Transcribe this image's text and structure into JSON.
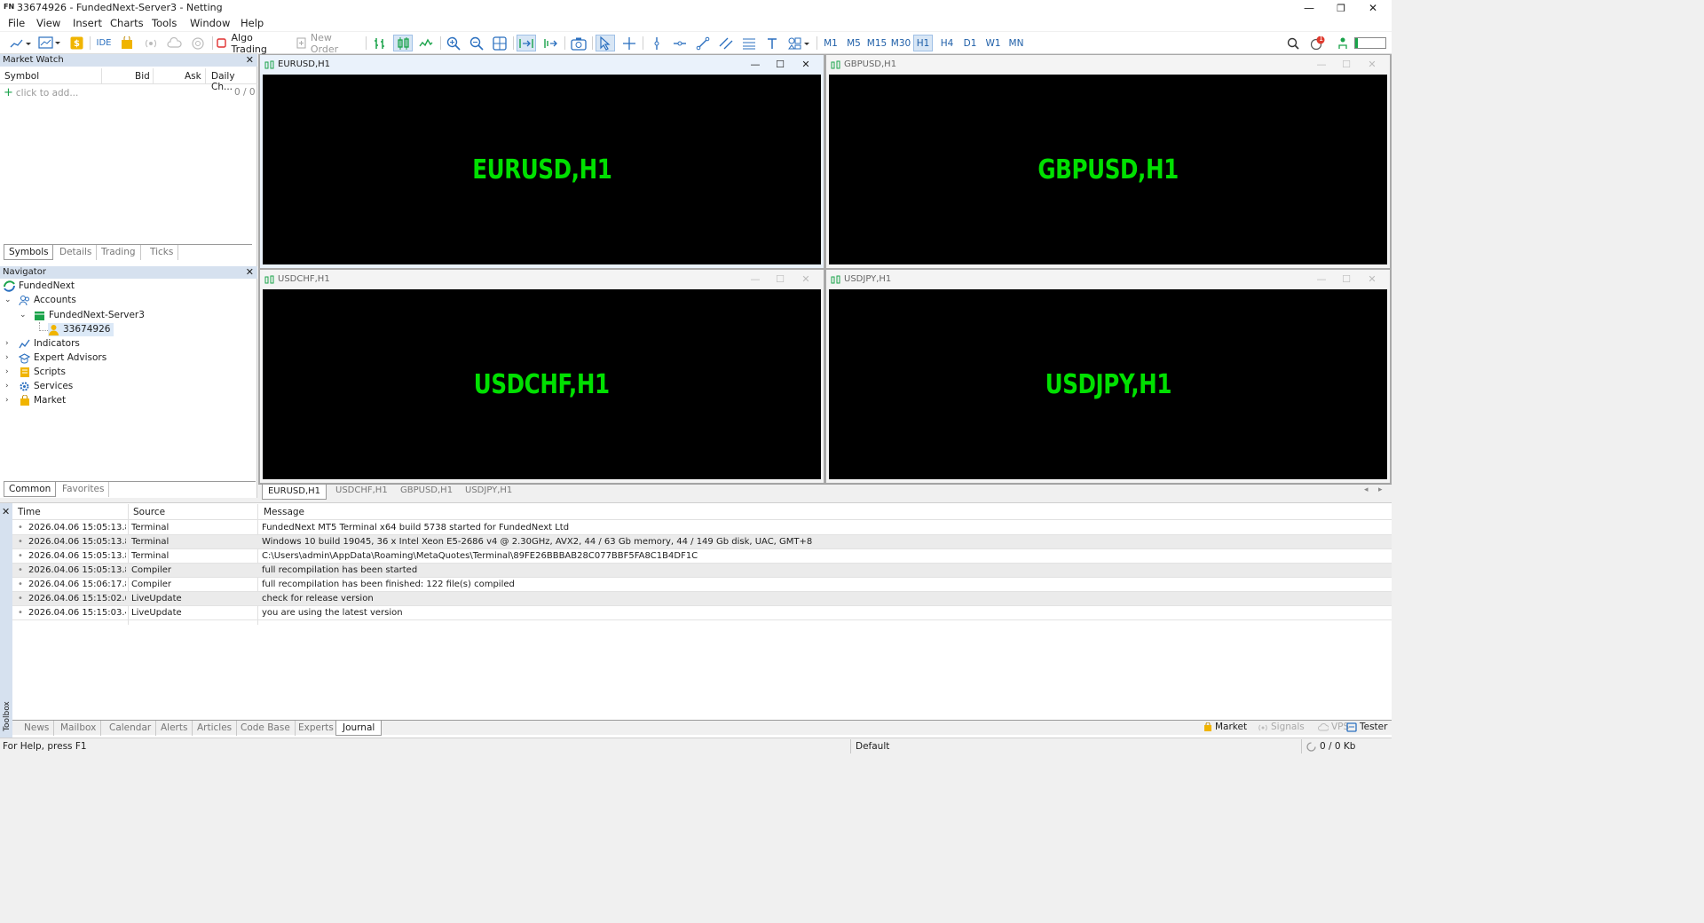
{
  "window": {
    "logo": "FN",
    "title": "33674926 - FundedNext-Server3 - Netting",
    "minimize": "—",
    "restore": "❐",
    "close": "✕"
  },
  "menu": [
    "File",
    "View",
    "Insert",
    "Charts",
    "Tools",
    "Window",
    "Help"
  ],
  "toolbar": {
    "ide_label": "IDE",
    "algo_trading": "Algo Trading",
    "new_order": "New Order",
    "timeframes": [
      "M1",
      "M5",
      "M15",
      "M30",
      "H1",
      "H4",
      "D1",
      "W1",
      "MN"
    ],
    "active_timeframe": "H1",
    "notification_count": "1"
  },
  "market_watch": {
    "title": "Market Watch",
    "columns": [
      "Symbol",
      "Bid",
      "Ask",
      "Daily Ch..."
    ],
    "add_placeholder": "click to add...",
    "count": "0 / 0",
    "tabs": [
      "Symbols",
      "Details",
      "Trading",
      "Ticks"
    ],
    "active_tab": "Symbols"
  },
  "navigator": {
    "title": "Navigator",
    "root": "FundedNext",
    "accounts": "Accounts",
    "server": "FundedNext-Server3",
    "account": "33674926",
    "items": [
      "Indicators",
      "Expert Advisors",
      "Scripts",
      "Services",
      "Market"
    ],
    "tabs": [
      "Common",
      "Favorites"
    ],
    "active_tab": "Common"
  },
  "charts": [
    {
      "caption": "EURUSD,H1",
      "label": "EURUSD,H1",
      "active": true
    },
    {
      "caption": "GBPUSD,H1",
      "label": "GBPUSD,H1",
      "active": false
    },
    {
      "caption": "USDCHF,H1",
      "label": "USDCHF,H1",
      "active": false
    },
    {
      "caption": "USDJPY,H1",
      "label": "USDJPY,H1",
      "active": false
    }
  ],
  "chart_tabs": [
    "EURUSD,H1",
    "USDCHF,H1",
    "GBPUSD,H1",
    "USDJPY,H1"
  ],
  "chart_label_color": "#00e000",
  "journal": {
    "columns": [
      "Time",
      "Source",
      "Message"
    ],
    "rows": [
      {
        "time": "2026.04.06 15:05:13.8...",
        "source": "Terminal",
        "message": "FundedNext MT5 Terminal x64 build 5738 started for FundedNext Ltd"
      },
      {
        "time": "2026.04.06 15:05:13.8...",
        "source": "Terminal",
        "message": "Windows 10 build 19045, 36 x Intel Xeon  E5-2686 v4 @ 2.30GHz, AVX2, 44 / 63 Gb memory, 44 / 149 Gb disk, UAC, GMT+8"
      },
      {
        "time": "2026.04.06 15:05:13.8...",
        "source": "Terminal",
        "message": "C:\\Users\\admin\\AppData\\Roaming\\MetaQuotes\\Terminal\\89FE26BBBAB28C077BBF5FA8C1B4DF1C"
      },
      {
        "time": "2026.04.06 15:05:13.8...",
        "source": "Compiler",
        "message": "full recompilation has been started"
      },
      {
        "time": "2026.04.06 15:06:17.8...",
        "source": "Compiler",
        "message": "full recompilation has been finished:  122 file(s) compiled"
      },
      {
        "time": "2026.04.06 15:15:02.6...",
        "source": "LiveUpdate",
        "message": "check for release version"
      },
      {
        "time": "2026.04.06 15:15:03.4...",
        "source": "LiveUpdate",
        "message": "you are using the latest version"
      }
    ]
  },
  "toolbox": {
    "label": "Toolbox",
    "tabs": [
      "News",
      "Mailbox",
      "Calendar",
      "Alerts",
      "Articles",
      "Code Base",
      "Experts",
      "Journal"
    ],
    "active_tab": "Journal",
    "right_tabs": [
      "Market",
      "Signals",
      "VPS",
      "Tester"
    ]
  },
  "status": {
    "help": "For Help, press F1",
    "profile": "Default",
    "traffic": "0 / 0 Kb"
  }
}
